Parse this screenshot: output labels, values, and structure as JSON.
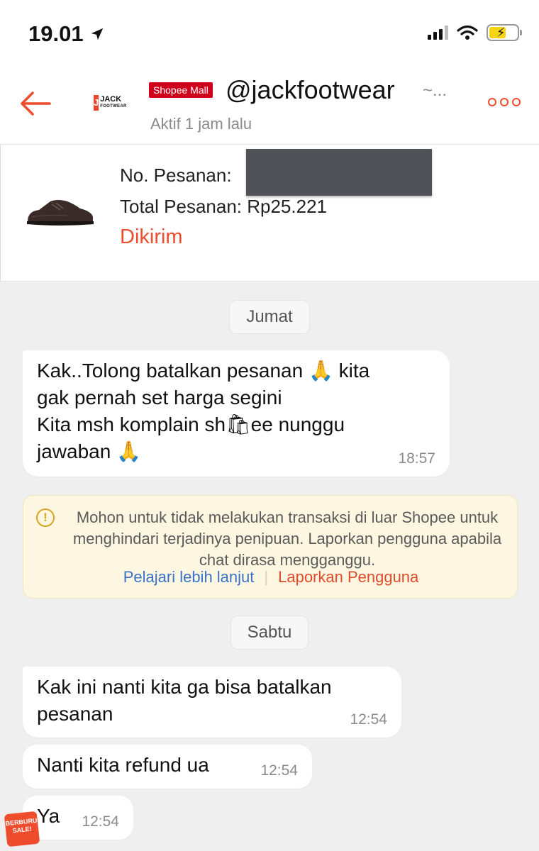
{
  "status_bar": {
    "time": "19.01"
  },
  "header": {
    "mall_badge": "Shopee Mall",
    "shop_name": "@jackfootwear",
    "shop_name_suffix": "~...",
    "active_status": "Aktif 1 jam lalu",
    "logo_brand": "JACK",
    "logo_sub": "FOOTWEAR",
    "logo_mark": "J"
  },
  "order": {
    "order_no_label": "No. Pesanan:",
    "total_label": "Total Pesanan: Rp25.221",
    "status": "Dikirim"
  },
  "chat": {
    "date_1": "Jumat",
    "msg_1_line_1": "Kak..Tolong batalkan pesanan",
    "msg_1_line_1_end": "kita",
    "msg_1_line_2": "gak pernah set harga segini",
    "msg_1_line_3a": "Kita msh komplain sh",
    "msg_1_line_3b": "ee nunggu",
    "msg_1_line_4": "jawaban",
    "msg_1_time": "18:57",
    "warning_text": "Mohon untuk tidak melakukan transaksi di luar Shopee untuk menghindari terjadinya penipuan. Laporkan pengguna apabila chat dirasa mengganggu.",
    "warning_link_learn": "Pelajari lebih lanjut",
    "warning_link_report": "Laporkan Pengguna",
    "date_2": "Sabtu",
    "msg_2_line_1": "Kak ini nanti kita ga bisa batalkan",
    "msg_2_line_2": "pesanan",
    "msg_2_time": "12:54",
    "msg_3": "Nanti kita refund ua",
    "msg_3_time": "12:54",
    "msg_4": "Ya",
    "msg_4_time": "12:54"
  },
  "sticker": {
    "text": "BERBURU SALE!"
  },
  "colors": {
    "brand": "#ee4d2d",
    "mall": "#d0011b",
    "link": "#3a72c8"
  },
  "icons": {
    "back": "arrow-left-icon",
    "more": "more-dots-icon",
    "warning": "info-circle-icon",
    "emoji": "folded-hands-icon"
  }
}
